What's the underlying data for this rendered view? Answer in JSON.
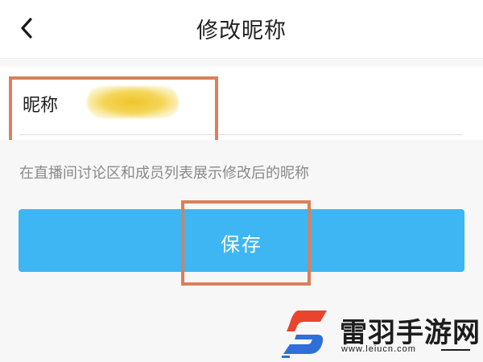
{
  "header": {
    "title": "修改昵称",
    "back_icon": "chevron-left-icon"
  },
  "form": {
    "nickname_label": "昵称",
    "nickname_value_obscured": true,
    "hint": "在直播间讨论区和成员列表展示修改后的昵称"
  },
  "actions": {
    "save_label": "保存"
  },
  "annotations": {
    "highlight_color": "#d9805a"
  },
  "colors": {
    "accent": "#3db6f3",
    "page_background": "#f7f7f7",
    "hint_text": "#8a8a8a"
  },
  "watermark": {
    "name": "雷羽手游网",
    "url": "www.leiucn.com",
    "logo_colors": [
      "#e8442e",
      "#2f6fd8"
    ]
  }
}
